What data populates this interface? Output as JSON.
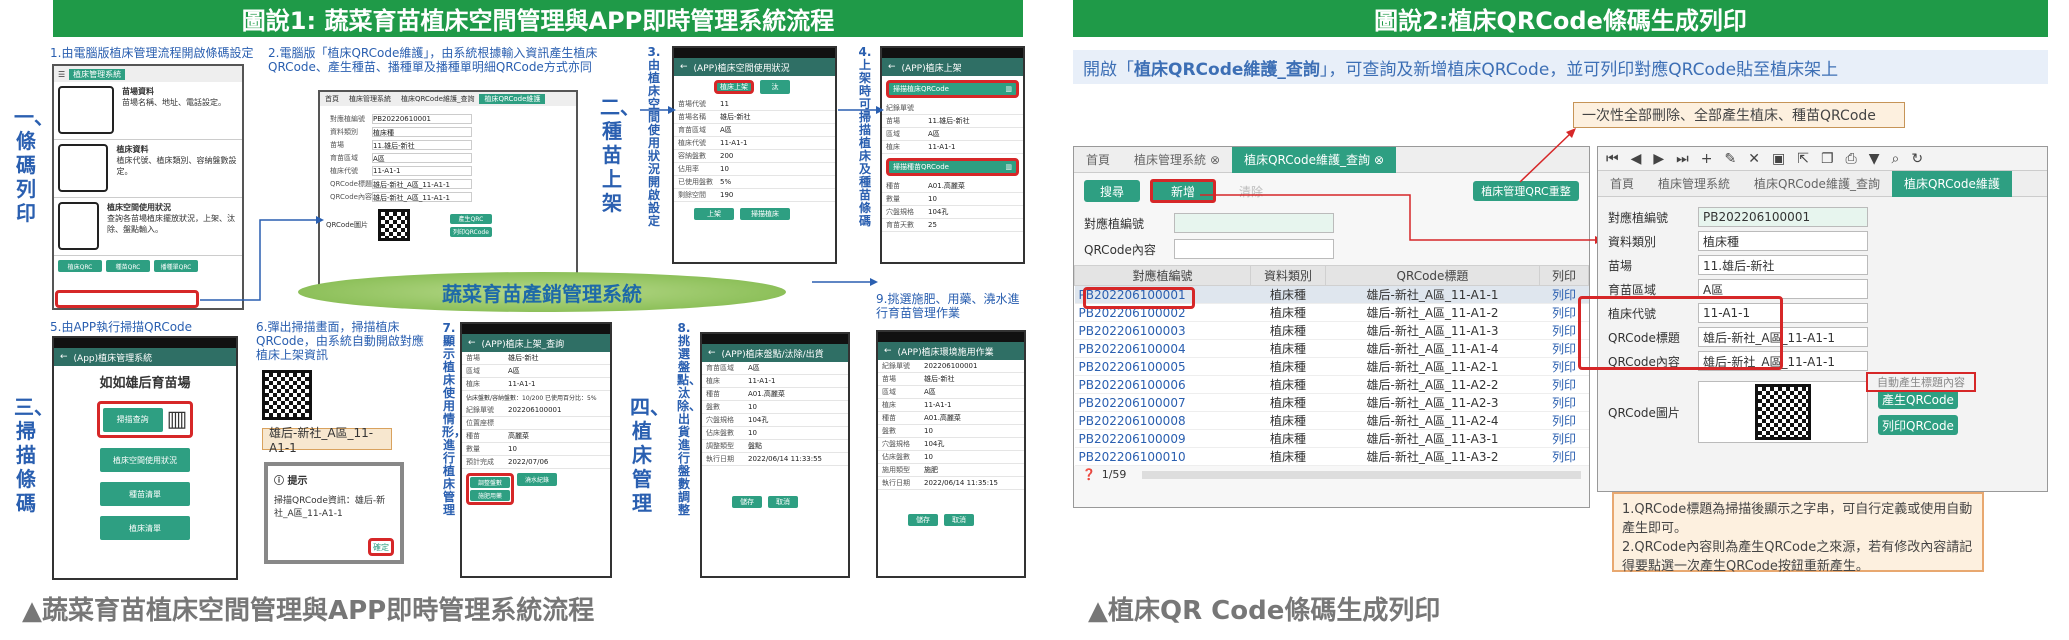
{
  "left": {
    "banner": "圖說1: 蔬菜育苗植床空間管理與APP即時管理系統流程",
    "step1": "1.由電腦版植床管理流程開啟條碼設定",
    "step2": "2.電腦版「植床QRCode維護」，由系統根據輸入資訊產生植床QRCode、產生種苗、播種單及播種單明細QRCode方式亦同",
    "step3": "3.由植床空間使用狀況開啟設定",
    "step4": "4.上架時可掃描植床及種苗條碼",
    "step5": "5.由APP執行掃描QRCode",
    "step6": "6.彈出掃描畫面，掃描植床QRCode，由系統自動開啟對應植床上架資訊",
    "step7": "7.顯示植床使用情形，進行植床管理",
    "step8": "8.挑選盤點、汰除、出貨進行盤數調整",
    "step9": "9.挑選施肥、用藥、澆水進行育苗管理作業",
    "side1": "一、條碼列印",
    "side2": "二、種苗上架",
    "side3": "三、掃描條碼",
    "side4": "四、植床管理",
    "ellipse": "蔬菜育苗產銷管理系統",
    "caption": "▲蔬菜育苗植床空間管理與APP即時管理系統流程",
    "pc_items": [
      {
        "title": "苗場資料",
        "desc": "苗場名稱、地址、電話設定。",
        "icon": "house-icon"
      },
      {
        "title": "植床資料",
        "desc": "植床代號、植床類別、容納盤數設定。",
        "icon": "seedling-icon"
      },
      {
        "title": "植床空間使用狀況",
        "desc": "查詢各苗場植床擺放狀況，上架、汰除、盤點輸入。",
        "icon": "pie-chart-icon"
      }
    ],
    "pc_buttons": [
      "植床QRC",
      "種苗QRC",
      "播種單QRC"
    ],
    "pc_tab": "植床管理系統",
    "qr_form": {
      "tabs": [
        "首頁",
        "植床管理系統",
        "植床QRCode維護_查詢",
        "植床QRCode維護"
      ],
      "rows": [
        {
          "k": "對應植編號",
          "v": "PB20220610001"
        },
        {
          "k": "資料類別",
          "v": "植床種"
        },
        {
          "k": "苗場",
          "v": "11.雄后-新社"
        },
        {
          "k": "育苗區域",
          "v": "A區"
        },
        {
          "k": "植床代號",
          "v": "11-A1-1"
        },
        {
          "k": "QRCode標題",
          "v": "雄后-新社_A區_11-A1-1"
        },
        {
          "k": "QRCode內容",
          "v": "雄后-新社_A區_11-A1-1"
        }
      ],
      "qr_label": "QRCode圖片",
      "btn_make": "產生QRC",
      "btn_print": "列印QRCode"
    },
    "app3": {
      "title": "(APP)植床空間使用狀況",
      "rows": [
        {
          "k": "苗場代號",
          "v": "11"
        },
        {
          "k": "苗場名稱",
          "v": "雄后-新社"
        },
        {
          "k": "育苗區域",
          "v": "A區"
        },
        {
          "k": "植床代號",
          "v": "11-A1-1"
        },
        {
          "k": "容納盤數",
          "v": "200"
        },
        {
          "k": "佔用率",
          "v": "10"
        },
        {
          "k": "已使用盤數",
          "v": "5%"
        },
        {
          "k": "剩餘空間",
          "v": "190"
        }
      ],
      "btn_a": "植床上架",
      "btn_b": "汰",
      "foot_btns": [
        "上架",
        "掃描植床"
      ]
    },
    "app4": {
      "title": "(APP)植床上架",
      "rows": [
        {
          "k": "紀錄單號",
          "v": ""
        },
        {
          "k": "苗場",
          "v": "11.雄后-新社"
        },
        {
          "k": "區域",
          "v": "A區"
        },
        {
          "k": "植床",
          "v": "11-A1-1"
        },
        {
          "k": "種苗",
          "v": "A01.高麗菜"
        },
        {
          "k": "數量",
          "v": "10"
        },
        {
          "k": "穴盤規格",
          "v": "104孔"
        },
        {
          "k": "育苗天數",
          "v": "25"
        }
      ],
      "scan1": "掃描植床QRCode",
      "scan2": "掃描種苗QRCode"
    },
    "app5": {
      "title": "(App)植床管理系統",
      "heading": "如如雄后育苗場",
      "buttons": [
        "掃描查詢",
        "植床空間使用狀況",
        "種苗清單",
        "植床清單"
      ]
    },
    "app6": {
      "qr_text": "雄后-新社_A區_11-A1-1",
      "dialog_title": "提示",
      "dialog_text": "掃描QRCode資訊：雄后-新社_A區_11-A1-1",
      "dialog_btn": "確定"
    },
    "app7": {
      "title": "(APP)植床上架_查詢",
      "rows": [
        {
          "k": "苗場",
          "v": "雄后-新社"
        },
        {
          "k": "區域",
          "v": "A區"
        },
        {
          "k": "植床",
          "v": "11-A1-1"
        },
        {
          "k": "紀錄單號",
          "v": "202206100001"
        },
        {
          "k": "位置座標",
          "v": ""
        },
        {
          "k": "種苗",
          "v": "高麗菜"
        },
        {
          "k": "數量",
          "v": "10"
        },
        {
          "k": "預計完成",
          "v": "2022/07/06"
        }
      ],
      "used": "佔床盤數/容納盤數：10/200 已使用百分比：5%",
      "btn_a": "調整盤數",
      "btn_b": "施肥用藥",
      "btn_c": "澆水紀錄"
    },
    "app8": {
      "title": "(APP)植床盤點/汰除/出貨",
      "rows": [
        {
          "k": "育苗區域",
          "v": "A區"
        },
        {
          "k": "植床",
          "v": "11-A1-1"
        },
        {
          "k": "種苗",
          "v": "A01.高麗菜"
        },
        {
          "k": "盤數",
          "v": "10"
        },
        {
          "k": "穴盤規格",
          "v": "104孔"
        },
        {
          "k": "佔床盤數",
          "v": "10"
        },
        {
          "k": "調整類型",
          "v": "盤點"
        },
        {
          "k": "執行日期",
          "v": "2022/06/14 11:33:55"
        }
      ],
      "foot_btns": [
        "儲存",
        "取消"
      ]
    },
    "app9": {
      "title": "(APP)植床環境施用作業",
      "rows": [
        {
          "k": "紀錄單號",
          "v": "202206100001"
        },
        {
          "k": "苗場",
          "v": "雄后-新社"
        },
        {
          "k": "區域",
          "v": "A區"
        },
        {
          "k": "植床",
          "v": "11-A1-1"
        },
        {
          "k": "種苗",
          "v": "A01.高麗菜"
        },
        {
          "k": "盤數",
          "v": "10"
        },
        {
          "k": "穴盤規格",
          "v": "104孔"
        },
        {
          "k": "佔床盤數",
          "v": "10"
        },
        {
          "k": "施用類型",
          "v": "施肥"
        },
        {
          "k": "執行日期",
          "v": "2022/06/14 11:35:15"
        }
      ],
      "foot_btns": [
        "儲存",
        "取消"
      ]
    }
  },
  "right": {
    "banner": "圖說2:植床QRCode條碼生成列印",
    "intro_pre": "開啟「",
    "intro_bold": "植床QRCode維護_查詢",
    "intro_post": "」，可查詢及新增植床QRCode，並可列印對應QRCode貼至植床架上",
    "callout": "一次性全部刪除、全部產生植床、種苗QRCode",
    "caption": "▲植床QR Code條碼生成列印",
    "query": {
      "tabs": [
        "首頁",
        "植床管理系統",
        "植床QRCode維護_查詢"
      ],
      "btn_search": "搜尋",
      "btn_new": "新增",
      "btn_clear": "清除",
      "btn_regen": "植床管理QRC重整",
      "label_no": "對應植編號",
      "label_content": "QRCode內容",
      "columns": [
        "對應植編號",
        "資料類別",
        "QRCode標題",
        "列印"
      ],
      "rows": [
        [
          "PB202206100001",
          "植床種",
          "雄后-新社_A區_11-A1-1",
          "列印"
        ],
        [
          "PB202206100002",
          "植床種",
          "雄后-新社_A區_11-A1-2",
          "列印"
        ],
        [
          "PB202206100003",
          "植床種",
          "雄后-新社_A區_11-A1-3",
          "列印"
        ],
        [
          "PB202206100004",
          "植床種",
          "雄后-新社_A區_11-A1-4",
          "列印"
        ],
        [
          "PB202206100005",
          "植床種",
          "雄后-新社_A區_11-A2-1",
          "列印"
        ],
        [
          "PB202206100006",
          "植床種",
          "雄后-新社_A區_11-A2-2",
          "列印"
        ],
        [
          "PB202206100007",
          "植床種",
          "雄后-新社_A區_11-A2-3",
          "列印"
        ],
        [
          "PB202206100008",
          "植床種",
          "雄后-新社_A區_11-A2-4",
          "列印"
        ],
        [
          "PB202206100009",
          "植床種",
          "雄后-新社_A區_11-A3-1",
          "列印"
        ],
        [
          "PB202206100010",
          "植床種",
          "雄后-新社_A區_11-A3-2",
          "列印"
        ]
      ],
      "pager": "1/59"
    },
    "form": {
      "tabs": [
        "首頁",
        "植床管理系統",
        "植床QRCode維護_查詢",
        "植床QRCode維護"
      ],
      "fields": [
        {
          "label": "對應植編號",
          "value": "PB202206100001"
        },
        {
          "label": "資料類別",
          "value": "植床種"
        },
        {
          "label": "苗場",
          "value": "11.雄后-新社"
        },
        {
          "label": "育苗區域",
          "value": "A區"
        },
        {
          "label": "植床代號",
          "value": "11-A1-1"
        },
        {
          "label": "QRCode標題",
          "value": "雄后-新社_A區_11-A1-1"
        },
        {
          "label": "QRCode內容",
          "value": "雄后-新社_A區_11-A1-1"
        }
      ],
      "auto_title": "自動產生標題內容",
      "qr_label": "QRCode圖片",
      "btn_make": "產生QRCode",
      "btn_print": "列印QRCode"
    },
    "note": [
      "1.QRCode標題為掃描後顯示之字串，可自行定義或使用自動產生即可。",
      "2.QRCode內容則為產生QRCode之來源，若有修改內容請記得要點選一次產生QRCode按鈕重新產生。"
    ]
  },
  "colors": {
    "banner": "#1f9a48",
    "accent": "#2e9f82",
    "red": "#d62728",
    "blue": "#2a5fb0"
  }
}
